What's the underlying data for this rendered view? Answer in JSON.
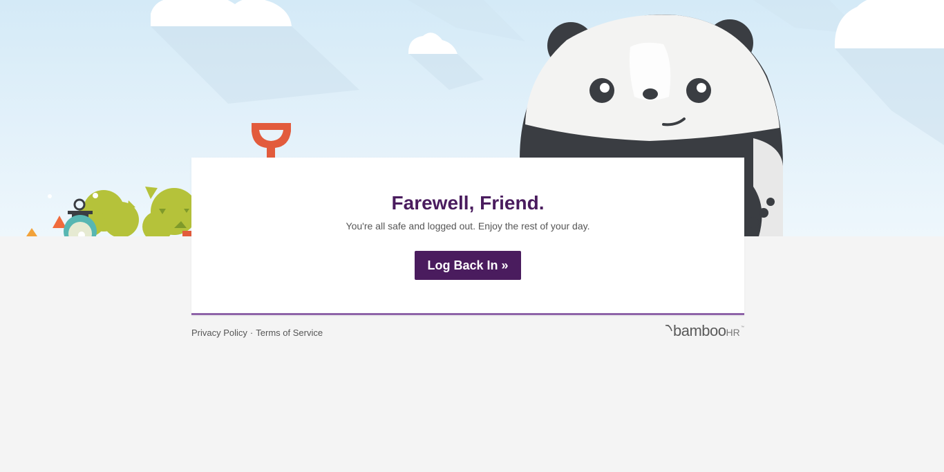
{
  "card": {
    "title": "Farewell, Friend.",
    "message": "You're all safe and logged out. Enjoy the rest of your day.",
    "button_label": "Log Back In »"
  },
  "footer": {
    "privacy_label": "Privacy Policy",
    "separator": "·",
    "terms_label": "Terms of Service"
  },
  "logo": {
    "brand_main": "bamboo",
    "brand_suffix": "HR",
    "trademark": "™"
  },
  "colors": {
    "brand_purple": "#4a1c5e",
    "accent_border": "#8e63a8",
    "sky_top": "#d4eaf7",
    "ground": "#f4f4f4"
  },
  "icons": [
    "panda-mascot",
    "shovel-icon",
    "bushes-decoration",
    "lantern-icon",
    "cloud-decoration",
    "bamboo-leaf-icon"
  ]
}
